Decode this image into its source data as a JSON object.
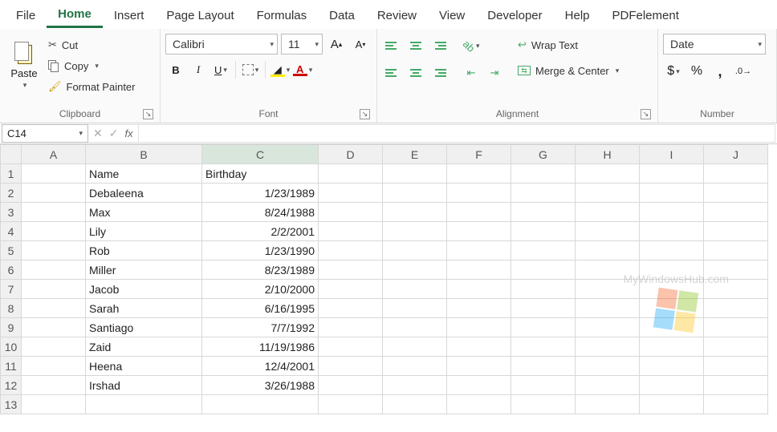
{
  "tabs": [
    "File",
    "Home",
    "Insert",
    "Page Layout",
    "Formulas",
    "Data",
    "Review",
    "View",
    "Developer",
    "Help",
    "PDFelement"
  ],
  "active_tab": "Home",
  "clipboard": {
    "paste": "Paste",
    "cut": "Cut",
    "copy": "Copy",
    "painter": "Format Painter",
    "label": "Clipboard"
  },
  "font": {
    "name": "Calibri",
    "size": "11",
    "label": "Font"
  },
  "alignment": {
    "wrap": "Wrap Text",
    "merge": "Merge & Center",
    "label": "Alignment"
  },
  "number": {
    "format": "Date",
    "label": "Number"
  },
  "namebox": "C14",
  "columns": [
    "A",
    "B",
    "C",
    "D",
    "E",
    "F",
    "G",
    "H",
    "I",
    "J"
  ],
  "selected_col": "C",
  "selected_row": 14,
  "headers": {
    "B": "Name",
    "C": "Birthday"
  },
  "rows": [
    {
      "n": 1,
      "B": "Name",
      "C": "Birthday",
      "C_align": "l"
    },
    {
      "n": 2,
      "B": "Debaleena",
      "C": "1/23/1989",
      "C_align": "r"
    },
    {
      "n": 3,
      "B": "Max",
      "C": "8/24/1988",
      "C_align": "r"
    },
    {
      "n": 4,
      "B": "Lily",
      "C": "2/2/2001",
      "C_align": "r"
    },
    {
      "n": 5,
      "B": "Rob",
      "C": "1/23/1990",
      "C_align": "r"
    },
    {
      "n": 6,
      "B": "Miller",
      "C": "8/23/1989",
      "C_align": "r"
    },
    {
      "n": 7,
      "B": "Jacob",
      "C": "2/10/2000",
      "C_align": "r"
    },
    {
      "n": 8,
      "B": "Sarah",
      "C": "6/16/1995",
      "C_align": "r"
    },
    {
      "n": 9,
      "B": "Santiago",
      "C": "7/7/1992",
      "C_align": "r"
    },
    {
      "n": 10,
      "B": "Zaid",
      "C": "11/19/1986",
      "C_align": "r"
    },
    {
      "n": 11,
      "B": "Heena",
      "C": "12/4/2001",
      "C_align": "r"
    },
    {
      "n": 12,
      "B": "Irshad",
      "C": "3/26/1988",
      "C_align": "r"
    },
    {
      "n": 13,
      "B": "",
      "C": "",
      "C_align": "l"
    }
  ],
  "watermark": "MyWindowsHub.com"
}
